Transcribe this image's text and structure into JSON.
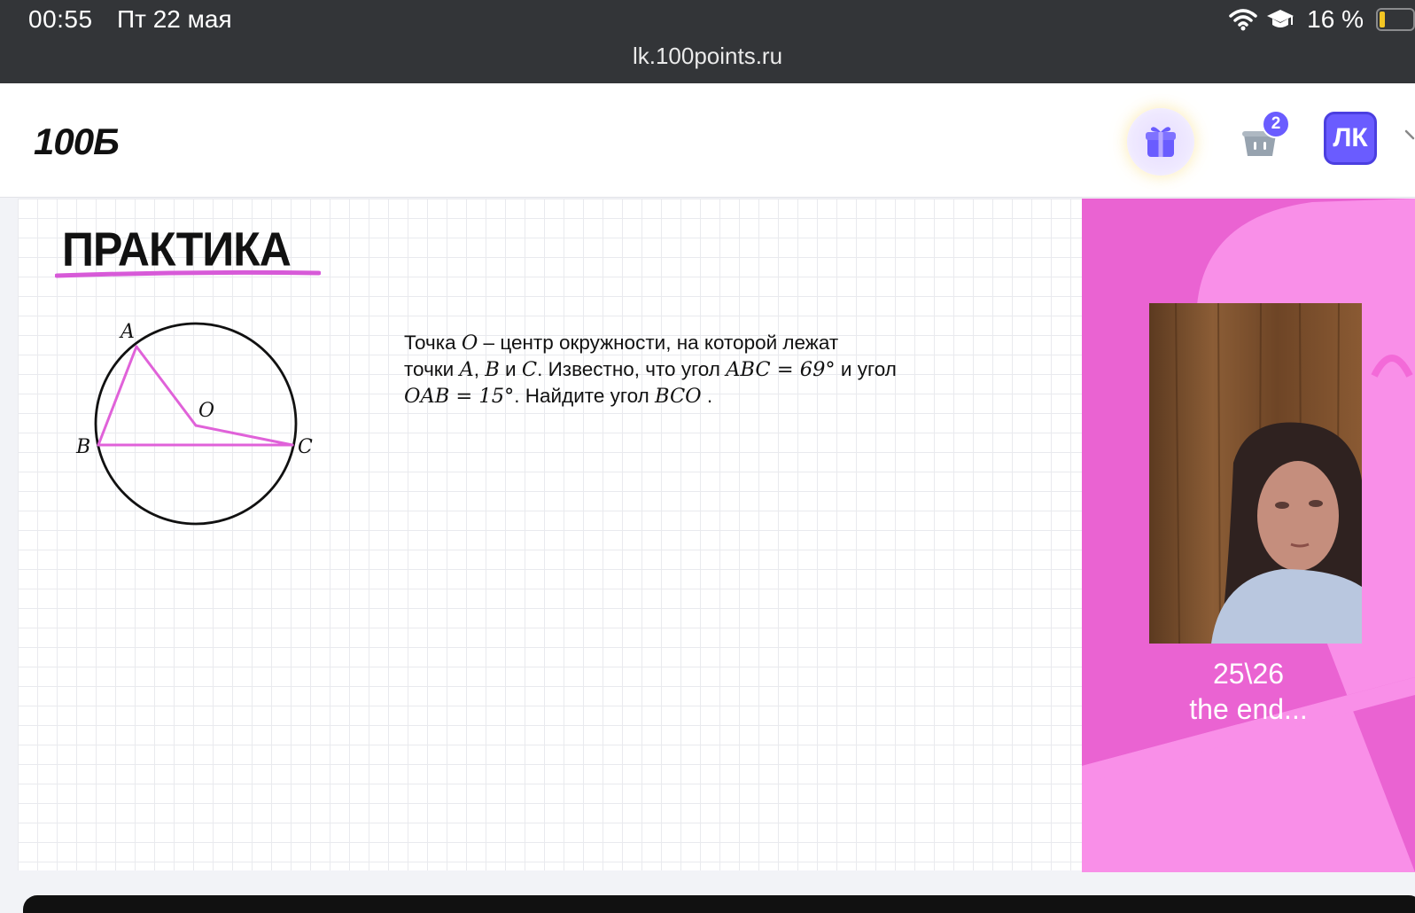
{
  "status_bar": {
    "time": "00:55",
    "date": "Пт 22 мая",
    "battery_percent": "16 %",
    "battery_level": 0.16,
    "url": "lk.100points.ru"
  },
  "header": {
    "logo": "100Б",
    "gift_icon": "gift-icon",
    "cart_icon": "basket-icon",
    "cart_count": "2",
    "profile_label": "ЛК",
    "chevron_icon": "chevron-right-icon",
    "accent_color": "#6a5cff"
  },
  "slide": {
    "title": "ПРАКТИКА",
    "underline_color": "#d75ad8",
    "figure": {
      "points": [
        "A",
        "B",
        "C",
        "O"
      ],
      "segment_color": "#e062d9"
    },
    "problem": {
      "line1_a": "Точка ",
      "line1_m": "O",
      "line1_b": " – центр окружности, на которой лежат",
      "line2_a": "точки ",
      "line2_m1": "A",
      "line2_b": ", ",
      "line2_m2": "B",
      "line2_c": " и ",
      "line2_m3": "C",
      "line2_d": ". Известно, что угол ",
      "line2_m4": "ABC = 69°",
      "line2_e": " и угол",
      "line3_m1": "OAB = 15°",
      "line3_a": ". Найдите угол ",
      "line3_m2": "BCO",
      "line3_b": " ."
    }
  },
  "side_panel": {
    "counter": "25\\26",
    "caption": "the end...",
    "bg_color": "#ea63d2"
  }
}
